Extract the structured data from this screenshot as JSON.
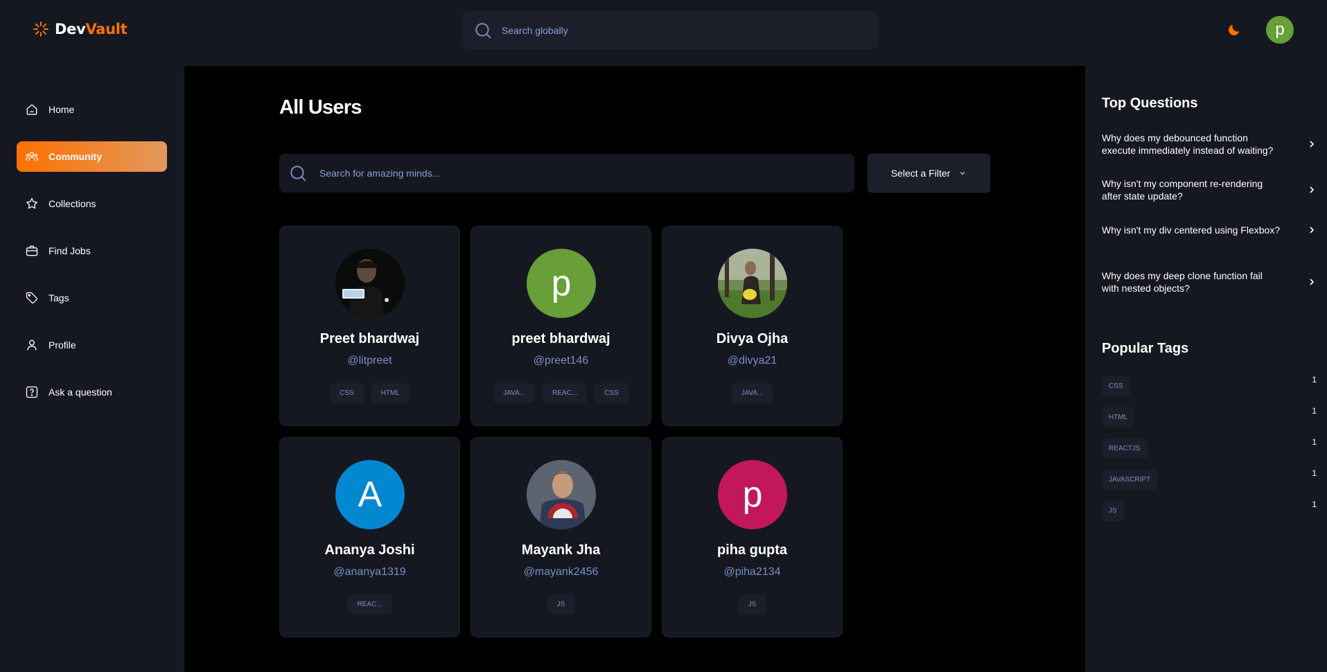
{
  "app": {
    "logo_part1": "Dev",
    "logo_part2": "Vault",
    "global_search_placeholder": "Search globally",
    "user_initial": "p",
    "colors": {
      "accent": "#ff7000",
      "bg": "#151821",
      "main_bg": "#000000",
      "muted_text": "#7b8ec8"
    }
  },
  "sidebar": {
    "items": [
      {
        "label": "Home",
        "icon": "home-icon",
        "active": false
      },
      {
        "label": "Community",
        "icon": "users-icon",
        "active": true
      },
      {
        "label": "Collections",
        "icon": "star-icon",
        "active": false
      },
      {
        "label": "Find Jobs",
        "icon": "suitcase-icon",
        "active": false
      },
      {
        "label": "Tags",
        "icon": "tag-icon",
        "active": false
      },
      {
        "label": "Profile",
        "icon": "user-icon",
        "active": false
      },
      {
        "label": "Ask a question",
        "icon": "question-icon",
        "active": false
      }
    ]
  },
  "main": {
    "title": "All Users",
    "search_placeholder": "Search for amazing minds...",
    "filter_label": "Select a Filter",
    "users": [
      {
        "name": "Preet bhardwaj",
        "handle": "@litpreet",
        "avatar_type": "photo",
        "tags": [
          "CSS",
          "HTML"
        ]
      },
      {
        "name": "preet bhardwaj",
        "handle": "@preet146",
        "avatar_type": "initial",
        "initial": "p",
        "avatar_color": "#689f38",
        "tags": [
          "JAVA...",
          "REAC...",
          "CSS"
        ]
      },
      {
        "name": "Divya Ojha",
        "handle": "@divya21",
        "avatar_type": "photo",
        "tags": [
          "JAVA..."
        ]
      },
      {
        "name": "Ananya Joshi",
        "handle": "@ananya1319",
        "avatar_type": "initial",
        "initial": "A",
        "avatar_color": "#0288d1",
        "tags": [
          "REAC..."
        ]
      },
      {
        "name": "Mayank Jha",
        "handle": "@mayank2456",
        "avatar_type": "photo",
        "tags": [
          "JS"
        ]
      },
      {
        "name": "piha gupta",
        "handle": "@piha2134",
        "avatar_type": "initial",
        "initial": "p",
        "avatar_color": "#c2185b",
        "tags": [
          "JS"
        ]
      }
    ]
  },
  "rightbar": {
    "top_questions_title": "Top Questions",
    "questions": [
      "Why does my debounced function execute immediately instead of waiting?",
      "Why isn't my component re-rendering after state update?",
      "Why isn't my div centered using Flexbox?",
      "Why does my deep clone function fail with nested objects?"
    ],
    "popular_tags_title": "Popular Tags",
    "tags": [
      {
        "name": "CSS",
        "count": "1"
      },
      {
        "name": "HTML",
        "count": "1"
      },
      {
        "name": "REACTJS",
        "count": "1"
      },
      {
        "name": "JAVASCRIPT",
        "count": "1"
      },
      {
        "name": "JS",
        "count": "1"
      }
    ]
  }
}
